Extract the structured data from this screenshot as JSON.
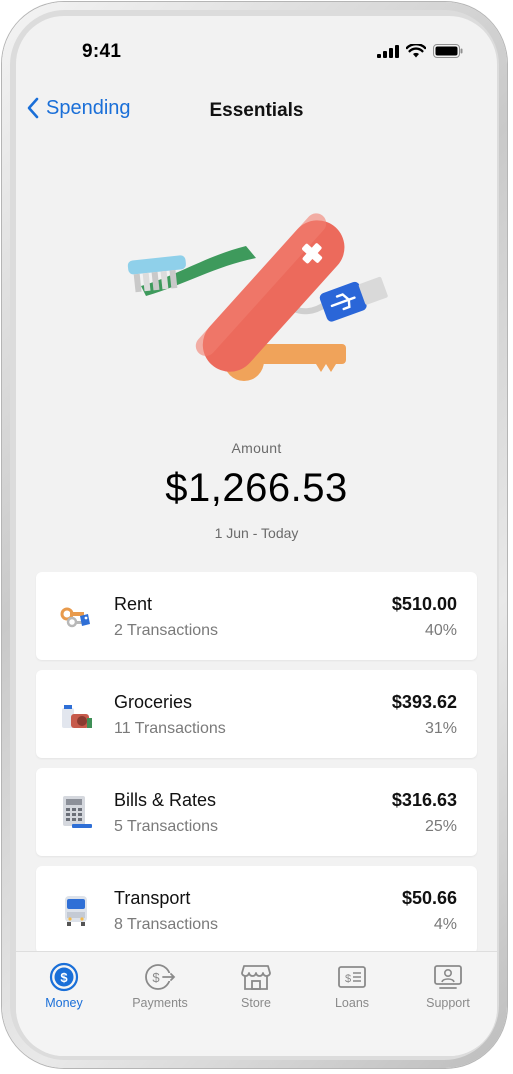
{
  "status_bar": {
    "time": "9:41"
  },
  "nav": {
    "back_label": "Spending",
    "title": "Essentials"
  },
  "summary": {
    "amount_label": "Amount",
    "amount": "$1,266.53",
    "date_range": "1 Jun - Today"
  },
  "categories": [
    {
      "name": "Rent",
      "transactions": "2 Transactions",
      "amount": "$510.00",
      "percent": "40%",
      "icon": "keys-icon"
    },
    {
      "name": "Groceries",
      "transactions": "11 Transactions",
      "amount": "$393.62",
      "percent": "31%",
      "icon": "groceries-icon"
    },
    {
      "name": "Bills & Rates",
      "transactions": "5 Transactions",
      "amount": "$316.63",
      "percent": "25%",
      "icon": "calculator-icon"
    },
    {
      "name": "Transport",
      "transactions": "8 Transactions",
      "amount": "$50.66",
      "percent": "4%",
      "icon": "bus-icon"
    }
  ],
  "tabs": [
    {
      "label": "Money",
      "icon": "money-icon",
      "active": true
    },
    {
      "label": "Payments",
      "icon": "payments-icon",
      "active": false
    },
    {
      "label": "Store",
      "icon": "store-icon",
      "active": false
    },
    {
      "label": "Loans",
      "icon": "loans-icon",
      "active": false
    },
    {
      "label": "Support",
      "icon": "support-icon",
      "active": false
    }
  ],
  "colors": {
    "accent": "#1a6fd8",
    "background": "#f2f2f2",
    "card": "#ffffff"
  }
}
